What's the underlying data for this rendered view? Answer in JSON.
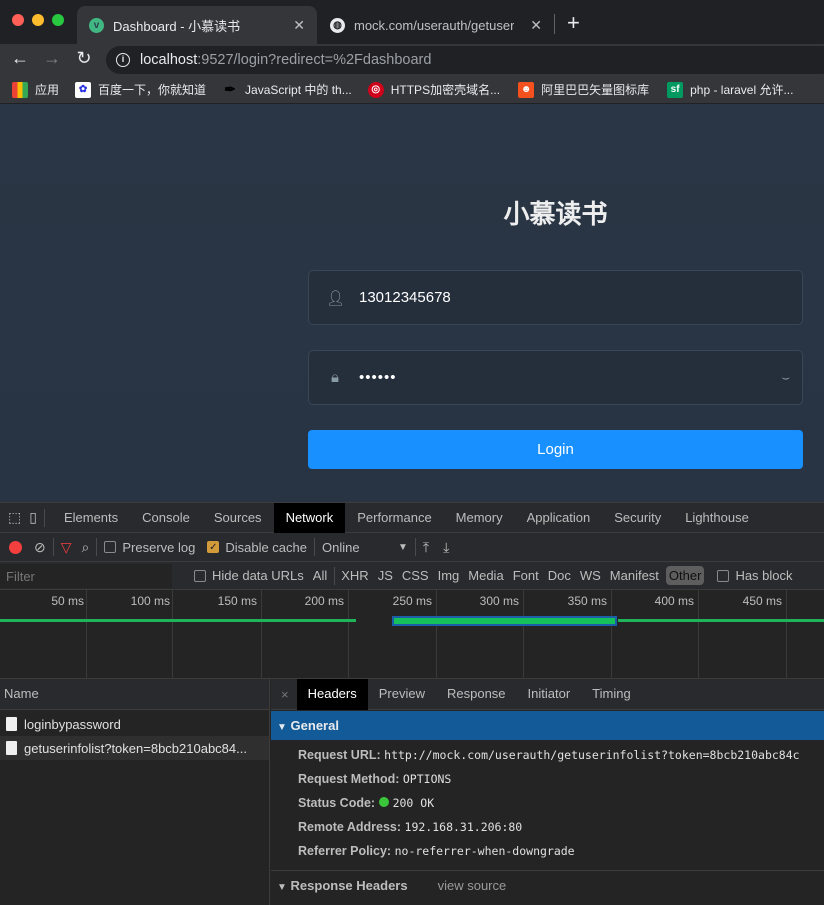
{
  "browser": {
    "tabs": [
      {
        "title": "Dashboard - 小慕读书",
        "icon": "vue-icon",
        "active": true
      },
      {
        "title": "mock.com/userauth/getuserinf",
        "icon": "globe-icon",
        "active": false
      }
    ],
    "new_tab": "+",
    "close": "✕",
    "url_host": "localhost",
    "url_rest": ":9527/login?redirect=%2Fdashboard",
    "bookmarks": [
      {
        "label": "应用",
        "icon": "apps-grid-icon"
      },
      {
        "label": "百度一下，你就知道",
        "icon": "baidu-icon"
      },
      {
        "label": "JavaScript 中的 th...",
        "icon": "quill-icon"
      },
      {
        "label": "HTTPS加密壳域名...",
        "icon": "red-swirl-icon"
      },
      {
        "label": "阿里巴巴矢量图标库",
        "icon": "iconfont-icon"
      },
      {
        "label": "php - laravel 允许...",
        "icon": "sf-icon",
        "icon_text": "sf"
      }
    ]
  },
  "login": {
    "title": "小慕读书",
    "username": "13012345678",
    "password_masked": "••••••",
    "button": "Login",
    "accent": "#1890ff"
  },
  "devtools": {
    "tabs": [
      "Elements",
      "Console",
      "Sources",
      "Network",
      "Performance",
      "Memory",
      "Application",
      "Security",
      "Lighthouse"
    ],
    "active_tab": "Network",
    "toolbar": {
      "preserve_log": "Preserve log",
      "preserve_log_checked": false,
      "disable_cache": "Disable cache",
      "disable_cache_checked": true,
      "throttle": "Online"
    },
    "filter": {
      "placeholder": "Filter",
      "hide_data_urls": "Hide data URLs",
      "types": [
        "All",
        "XHR",
        "JS",
        "CSS",
        "Img",
        "Media",
        "Font",
        "Doc",
        "WS",
        "Manifest",
        "Other"
      ],
      "active_type": "Other",
      "has_blocked": "Has block"
    },
    "timeline": {
      "ticks": [
        "50 ms",
        "100 ms",
        "150 ms",
        "200 ms",
        "250 ms",
        "300 ms",
        "350 ms",
        "400 ms",
        "450 ms"
      ]
    },
    "requests_header": "Name",
    "requests": [
      "loginbypassword",
      "getuserinfolist?token=8bcb210abc84..."
    ],
    "detail_tabs": [
      "Headers",
      "Preview",
      "Response",
      "Initiator",
      "Timing"
    ],
    "detail_close": "×",
    "general": {
      "title": "General",
      "rows": [
        {
          "k": "Request URL:",
          "v": "http://mock.com/userauth/getuserinfolist?token=8bcb210abc84c"
        },
        {
          "k": "Request Method:",
          "v": "OPTIONS"
        },
        {
          "k": "Status Code:",
          "v": "200 OK"
        },
        {
          "k": "Remote Address:",
          "v": "192.168.31.206:80"
        },
        {
          "k": "Referrer Policy:",
          "v": "no-referrer-when-downgrade"
        }
      ]
    },
    "response_headers": {
      "title": "Response Headers",
      "view_source": "view source"
    }
  }
}
